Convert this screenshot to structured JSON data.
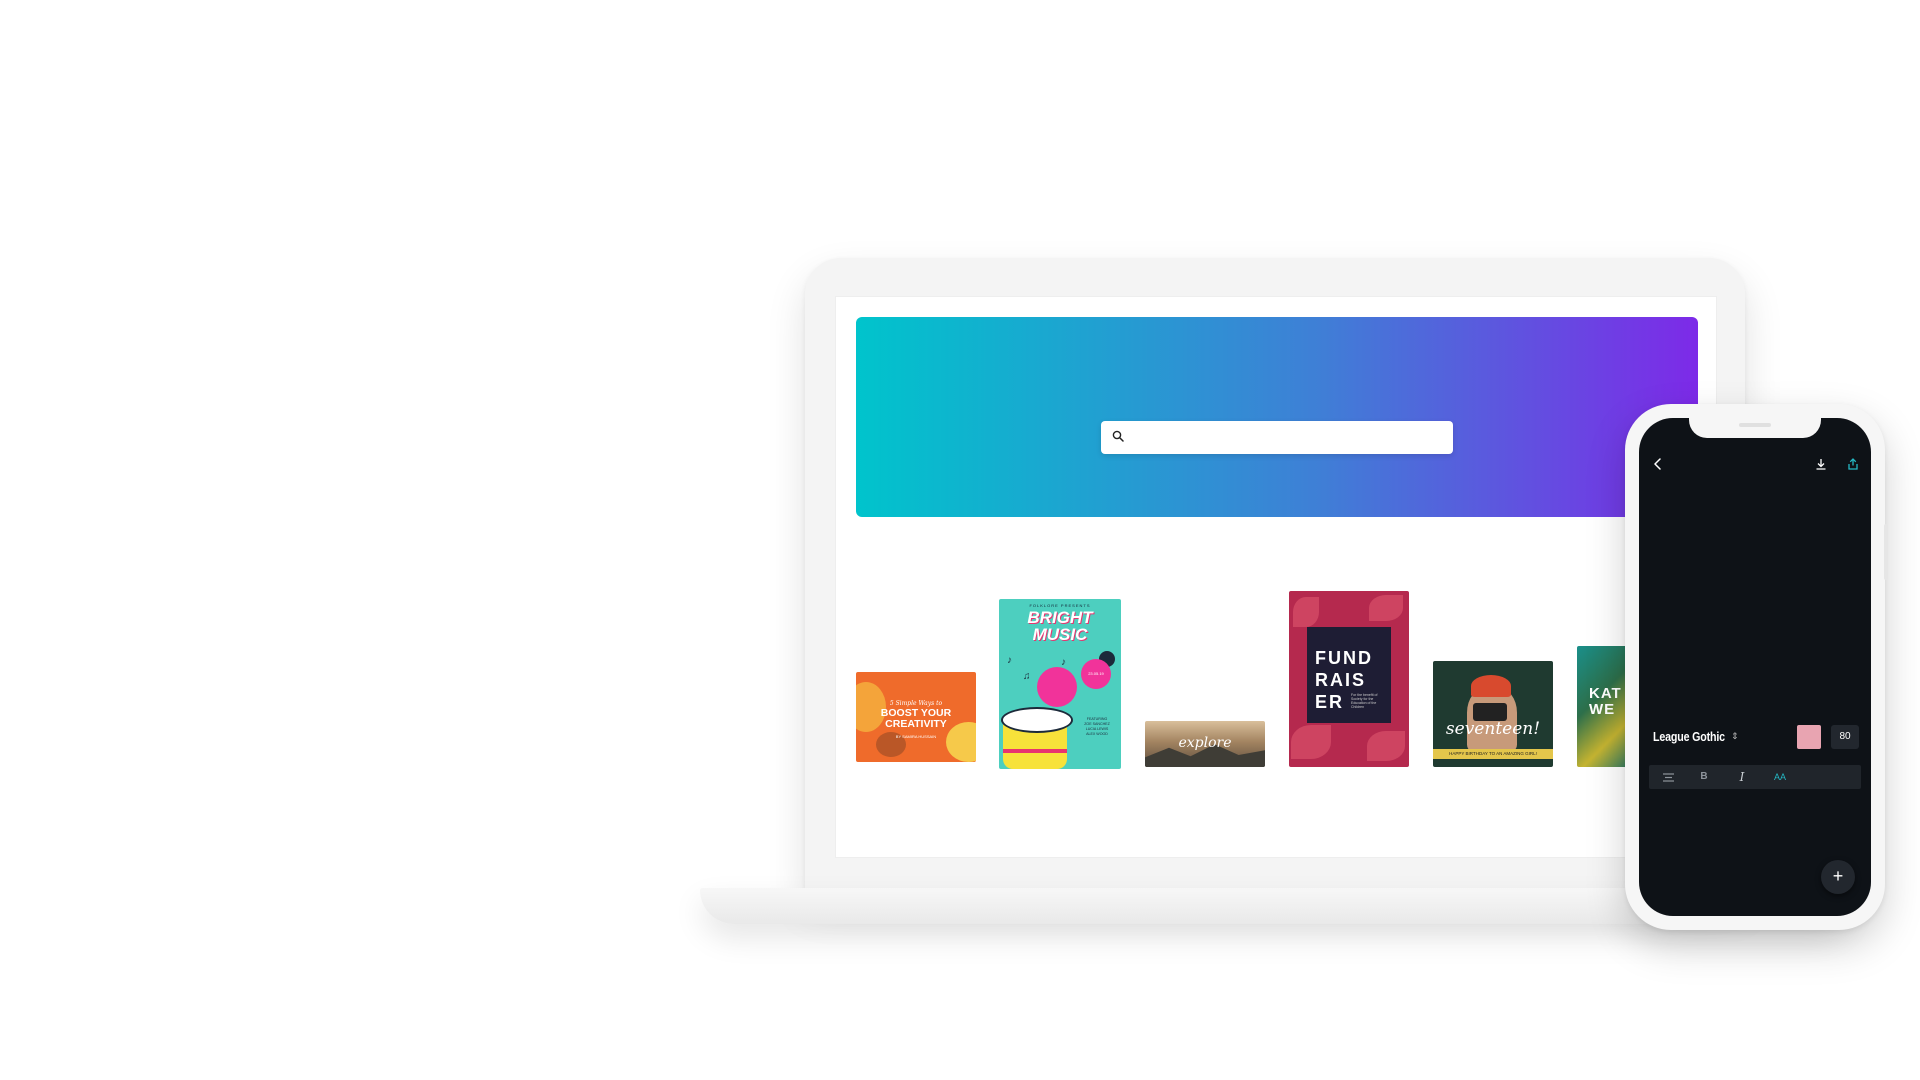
{
  "colors": {
    "hero_gradient_start": "#00c4cc",
    "hero_gradient_end": "#7d2ae8",
    "phone_screen_bg": "#0e1217",
    "text_color_swatch": "#e8a4b1",
    "accent": "#25b8c4"
  },
  "laptop": {
    "search": {
      "placeholder": "",
      "icon": "search-icon"
    },
    "templates": [
      {
        "id": "boost-creativity",
        "small_text": "5 Simple Ways to",
        "title_line1": "BOOST YOUR",
        "title_line2": "CREATIVITY",
        "tiny_text": "BY SAMIRA HUSSAIN"
      },
      {
        "id": "bright-music",
        "pre_text": "FOLKLORE PRESENTS",
        "title_line1": "BRIGHT",
        "title_line2": "MUSIC",
        "date": "23.05.19",
        "info_line1": "FEATURING",
        "info_line2": "ZOE SANCHEZ",
        "info_line3": "LUCIA LEWIS",
        "info_line4": "ALEX WOOD"
      },
      {
        "id": "explore",
        "word": "explore"
      },
      {
        "id": "fundraiser",
        "title_line1": "FUND",
        "title_line2": "RAIS",
        "title_line3": "ER",
        "sub_text": "For the benefit of Society for the Education of the Children"
      },
      {
        "id": "seventeen",
        "word": "seventeen!",
        "strip": "HAPPY BIRTHDAY TO AN AMAZING GIRL!"
      },
      {
        "id": "partial",
        "title_line1": "KAT",
        "title_line2": "WE"
      }
    ]
  },
  "phone": {
    "toolbar": {
      "back_icon": "chevron-left-icon",
      "download_icon": "download-icon",
      "share_icon": "share-icon"
    },
    "font_name": "League Gothic",
    "font_size": "80",
    "format": {
      "bold": "B",
      "italic": "I",
      "case": "AA",
      "align_icon": "align-center-icon"
    },
    "add_label": "+"
  }
}
